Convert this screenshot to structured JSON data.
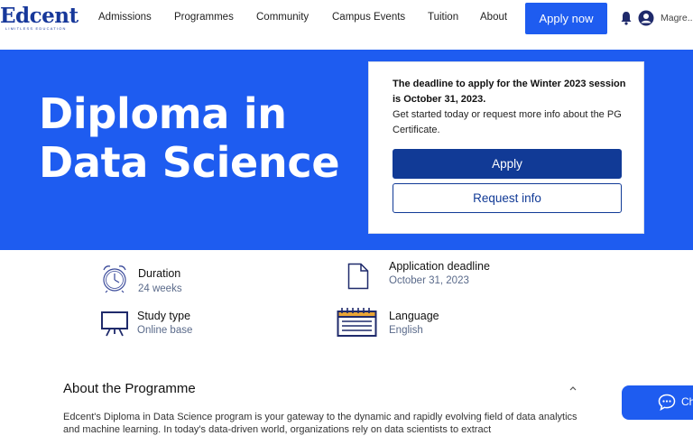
{
  "brand": {
    "name": "Edcent",
    "tagline": "LIMITLESS EDUCATION"
  },
  "nav": {
    "links": [
      "Admissions",
      "Programmes",
      "Community",
      "Campus Events",
      "Tuition",
      "About"
    ],
    "cta": "Apply now",
    "user": "Magre..."
  },
  "hero": {
    "title": "Diploma in Data Science",
    "card": {
      "deadline_text": "The deadline to apply for the Winter 2023 session is October 31, 2023.",
      "info_text": "Get started today or request more info about the PG Certificate.",
      "apply_label": "Apply",
      "request_label": "Request info"
    }
  },
  "details": [
    {
      "label": "Duration",
      "value": "24 weeks",
      "icon": "alarm-clock-icon"
    },
    {
      "label": "Application deadline",
      "value": "October 31, 2023",
      "icon": "document-icon"
    },
    {
      "label": "Study type",
      "value": "Online base",
      "icon": "presentation-board-icon"
    },
    {
      "label": "Language",
      "value": "English",
      "icon": "calendar-icon"
    }
  ],
  "about": {
    "heading": "About the Programme",
    "body": "Edcent's Diploma in Data Science program is your gateway to the dynamic and rapidly evolving field of data analytics and machine learning. In today's data-driven world, organizations rely on data scientists to extract"
  },
  "chat": {
    "label": "Ch"
  },
  "colors": {
    "primary": "#1e5cf0",
    "dark_blue": "#113a96",
    "icon_navy": "#1f2a6b"
  }
}
